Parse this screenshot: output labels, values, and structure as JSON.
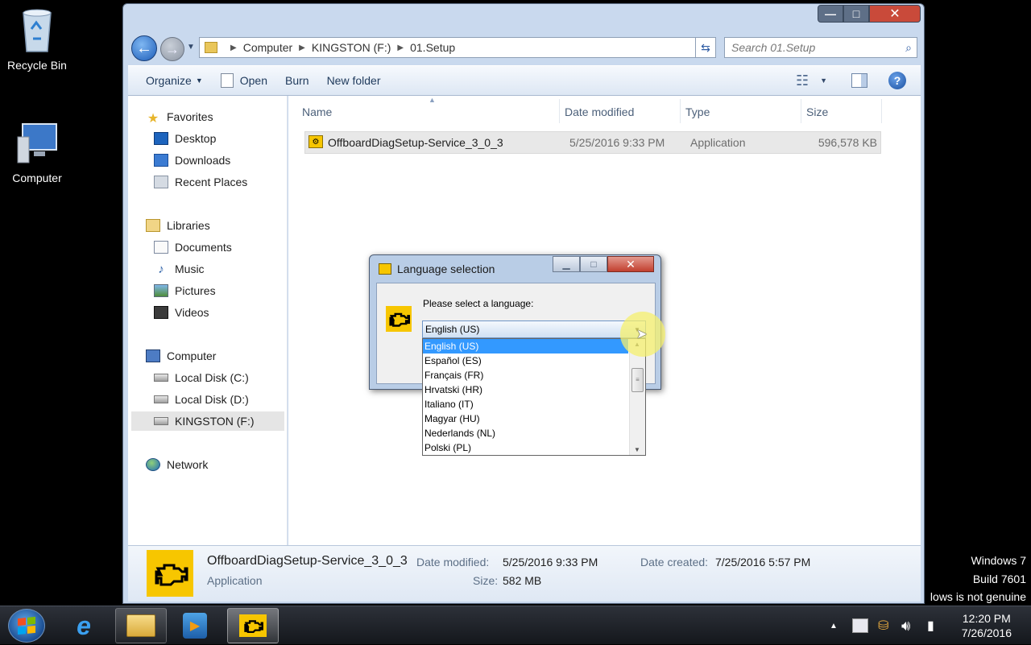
{
  "desktop": {
    "icons": [
      {
        "label": "Recycle Bin",
        "icon": "recycle-bin-icon"
      },
      {
        "label": "Computer",
        "icon": "computer-icon"
      }
    ]
  },
  "explorer": {
    "caption_buttons": {
      "minimize": "—",
      "maximize": "□",
      "close": "✕"
    },
    "breadcrumb": [
      "Computer",
      "KINGSTON (F:)",
      "01.Setup"
    ],
    "search_placeholder": "Search 01.Setup",
    "toolbar": {
      "organize": "Organize",
      "open": "Open",
      "burn": "Burn",
      "new_folder": "New folder"
    },
    "nav": {
      "favorites": {
        "header": "Favorites",
        "items": [
          "Desktop",
          "Downloads",
          "Recent Places"
        ]
      },
      "libraries": {
        "header": "Libraries",
        "items": [
          "Documents",
          "Music",
          "Pictures",
          "Videos"
        ]
      },
      "computer": {
        "header": "Computer",
        "items": [
          "Local Disk (C:)",
          "Local Disk (D:)",
          "KINGSTON (F:)"
        ],
        "selected": "KINGSTON (F:)"
      },
      "network": {
        "header": "Network"
      }
    },
    "columns": {
      "name": "Name",
      "date": "Date modified",
      "type": "Type",
      "size": "Size"
    },
    "files": [
      {
        "name": "OffboardDiagSetup-Service_3_0_3",
        "date": "5/25/2016 9:33 PM",
        "type": "Application",
        "size": "596,578 KB"
      }
    ],
    "details": {
      "name": "OffboardDiagSetup-Service_3_0_3",
      "type": "Application",
      "date_modified_label": "Date modified:",
      "date_modified": "5/25/2016 9:33 PM",
      "date_created_label": "Date created:",
      "date_created": "7/25/2016 5:57 PM",
      "size_label": "Size:",
      "size": "582 MB"
    }
  },
  "dialog": {
    "title": "Language selection",
    "prompt": "Please select a language:",
    "selected": "English (US)",
    "options": [
      "English (US)",
      "Español (ES)",
      "Français (FR)",
      "Hrvatski (HR)",
      "Italiano (IT)",
      "Magyar (HU)",
      "Nederlands (NL)",
      "Polski (PL)"
    ]
  },
  "watermark": {
    "line1": "Windows 7",
    "line2": "Build 7601",
    "line3": "lows is not genuine"
  },
  "taskbar": {
    "time": "12:20 PM",
    "date": "7/26/2016"
  },
  "colors": {
    "selection": "#3399ff",
    "app_icon": "#f7c600"
  }
}
